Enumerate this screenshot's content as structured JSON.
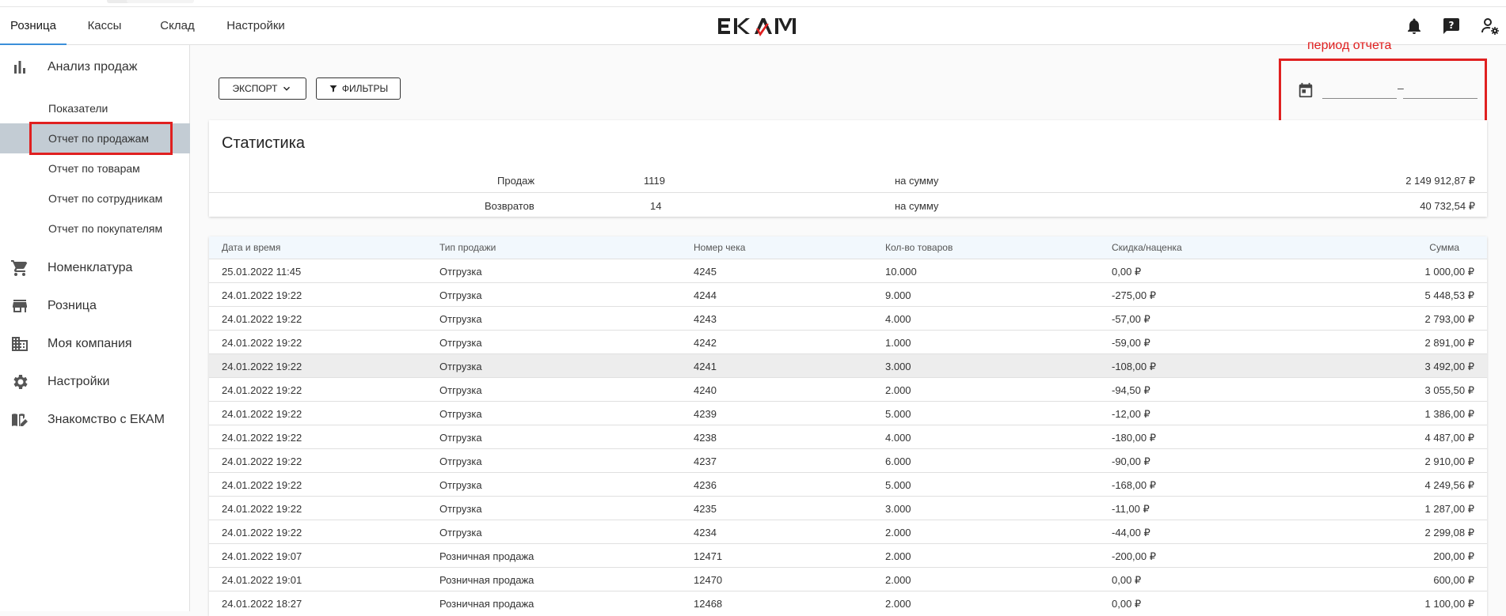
{
  "header": {
    "tabs": [
      "Розница",
      "Кассы",
      "Склад",
      "Настройки"
    ],
    "logo": "ЕКАМ"
  },
  "sidebar": {
    "sales_analysis": "Анализ продаж",
    "sub_items": [
      "Показатели",
      "Отчет по продажам",
      "Отчет по товарам",
      "Отчет по сотрудникам",
      "Отчет по покупателям"
    ],
    "main_items": [
      "Номенклатура",
      "Розница",
      "Моя компания",
      "Настройки",
      "Знакомство с ЕКАМ"
    ]
  },
  "toolbar": {
    "export_label": "Экспорт",
    "filters_label": "Фильтры"
  },
  "date_range": {
    "separator": "–",
    "annotation": "период отчета"
  },
  "statistics": {
    "title": "Статистика",
    "sales_label": "Продаж",
    "sales_count": "1119",
    "sales_sum_label": "на сумму",
    "sales_sum": "2 149 912,87 ₽",
    "returns_label": "Возвратов",
    "returns_count": "14",
    "returns_sum_label": "на сумму",
    "returns_sum": "40 732,54 ₽"
  },
  "table": {
    "columns": [
      "Дата и время",
      "Тип продажи",
      "Номер чека",
      "Кол-во товаров",
      "Скидка/наценка",
      "Сумма"
    ],
    "rows": [
      [
        "25.01.2022 11:45",
        "Отгрузка",
        "4245",
        "10.000",
        "0,00 ₽",
        "1 000,00 ₽"
      ],
      [
        "24.01.2022 19:22",
        "Отгрузка",
        "4244",
        "9.000",
        "-275,00 ₽",
        "5 448,53 ₽"
      ],
      [
        "24.01.2022 19:22",
        "Отгрузка",
        "4243",
        "4.000",
        "-57,00 ₽",
        "2 793,00 ₽"
      ],
      [
        "24.01.2022 19:22",
        "Отгрузка",
        "4242",
        "1.000",
        "-59,00 ₽",
        "2 891,00 ₽"
      ],
      [
        "24.01.2022 19:22",
        "Отгрузка",
        "4241",
        "3.000",
        "-108,00 ₽",
        "3 492,00 ₽"
      ],
      [
        "24.01.2022 19:22",
        "Отгрузка",
        "4240",
        "2.000",
        "-94,50 ₽",
        "3 055,50 ₽"
      ],
      [
        "24.01.2022 19:22",
        "Отгрузка",
        "4239",
        "5.000",
        "-12,00 ₽",
        "1 386,00 ₽"
      ],
      [
        "24.01.2022 19:22",
        "Отгрузка",
        "4238",
        "4.000",
        "-180,00 ₽",
        "4 487,00 ₽"
      ],
      [
        "24.01.2022 19:22",
        "Отгрузка",
        "4237",
        "6.000",
        "-90,00 ₽",
        "2 910,00 ₽"
      ],
      [
        "24.01.2022 19:22",
        "Отгрузка",
        "4236",
        "5.000",
        "-168,00 ₽",
        "4 249,56 ₽"
      ],
      [
        "24.01.2022 19:22",
        "Отгрузка",
        "4235",
        "3.000",
        "-11,00 ₽",
        "1 287,00 ₽"
      ],
      [
        "24.01.2022 19:22",
        "Отгрузка",
        "4234",
        "2.000",
        "-44,00 ₽",
        "2 299,08 ₽"
      ],
      [
        "24.01.2022 19:07",
        "Розничная продажа",
        "12471",
        "2.000",
        "-200,00 ₽",
        "200,00 ₽"
      ],
      [
        "24.01.2022 19:01",
        "Розничная продажа",
        "12470",
        "2.000",
        "0,00 ₽",
        "600,00 ₽"
      ],
      [
        "24.01.2022 18:27",
        "Розничная продажа",
        "12468",
        "2.000",
        "0,00 ₽",
        "1 100,00 ₽"
      ]
    ],
    "highlighted_row": 4
  },
  "colors": {
    "accent": "#3b8fd9",
    "annotation_red": "#e02020",
    "active_item_bg": "#c3ccd4",
    "table_header_bg": "#f2f8fd"
  }
}
